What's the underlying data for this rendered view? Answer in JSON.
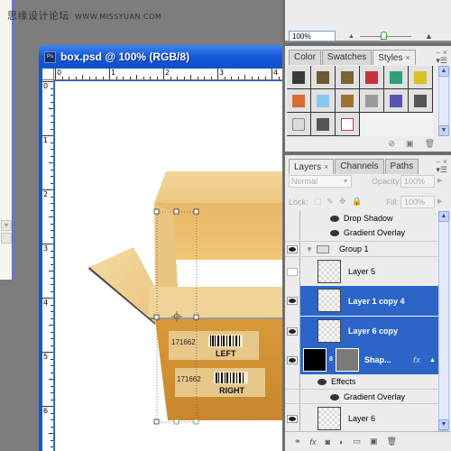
{
  "watermark": {
    "chinese": "思缘设计论坛",
    "url": "WWW.MISSYUAN.COM"
  },
  "document": {
    "title": "box.psd @ 100% (RGB/8)",
    "app_icon": "Ps",
    "ruler_h_labels": [
      "0",
      "1",
      "2",
      "3",
      "4"
    ],
    "ruler_v_labels": [
      "0",
      "1",
      "2",
      "3",
      "4",
      "5",
      "6"
    ],
    "artwork": {
      "label_numbers": [
        "171662",
        "171662"
      ],
      "label_texts": [
        "LEFT",
        "RIGHT"
      ]
    }
  },
  "navigator": {
    "zoom_value": "100%",
    "zoom_slider_fraction": 0.45,
    "zoom_out_icon": "small-mountain-icon",
    "zoom_in_icon": "large-mountain-icon"
  },
  "styles_panel": {
    "tabs": [
      {
        "label": "Color",
        "active": false
      },
      {
        "label": "Swatches",
        "active": false
      },
      {
        "label": "Styles",
        "active": true,
        "closable": true
      }
    ],
    "swatches": [
      {
        "name": "dark-metal",
        "color": "#3a3a3a"
      },
      {
        "name": "bronze",
        "color": "#6e5a2e"
      },
      {
        "name": "bronze-2",
        "color": "#7a6432"
      },
      {
        "name": "red-gradient",
        "color": "#c8303c"
      },
      {
        "name": "rainbow",
        "color": "#2ea07a"
      },
      {
        "name": "gold",
        "color": "#d6c12a"
      },
      {
        "name": "sunset",
        "color": "#d86a34"
      },
      {
        "name": "sky-blue",
        "color": "#8cc7ef"
      },
      {
        "name": "landscape",
        "color": "#a07030"
      },
      {
        "name": "noise",
        "color": "#9a9a9a"
      },
      {
        "name": "purple-blue",
        "color": "#5a54b4"
      },
      {
        "name": "dark-gray",
        "color": "#555555"
      },
      {
        "name": "light-gray-rounded",
        "color": "#dcdcdc"
      },
      {
        "name": "dark-gray-2",
        "color": "#555555"
      },
      {
        "name": "none-red-outline",
        "color": "#ffffff"
      }
    ],
    "footer_icons": [
      "clear-style-icon",
      "new-style-icon",
      "delete-icon"
    ]
  },
  "layers_panel": {
    "tabs": [
      {
        "label": "Layers",
        "active": true,
        "closable": true
      },
      {
        "label": "Channels",
        "active": false
      },
      {
        "label": "Paths",
        "active": false
      }
    ],
    "blend_mode": "Normal",
    "opacity_label": "Opacity:",
    "opacity_value": "100%",
    "lock_label": "Lock:",
    "fill_label": "Fill:",
    "fill_value": "100%",
    "rows": [
      {
        "type": "effect",
        "label": "Drop Shadow"
      },
      {
        "type": "effect",
        "label": "Gradient Overlay"
      },
      {
        "type": "group",
        "label": "Group 1",
        "visible": true
      },
      {
        "type": "layer",
        "label": "Layer 5",
        "visible": false,
        "selected": false
      },
      {
        "type": "layer",
        "label": "Layer 1 copy 4",
        "visible": true,
        "selected": true
      },
      {
        "type": "layer",
        "label": "Layer 6 copy",
        "visible": true,
        "selected": true
      },
      {
        "type": "shape",
        "label": "Shap...",
        "visible": true,
        "selected": true,
        "fx": "fx"
      },
      {
        "type": "effects-header",
        "label": "Effects"
      },
      {
        "type": "effect",
        "label": "Gradient Overlay"
      },
      {
        "type": "layer",
        "label": "Layer 6",
        "visible": true,
        "selected": false
      }
    ],
    "footer_icons": [
      "link-layers-icon",
      "fx-icon",
      "add-mask-icon",
      "adjustment-layer-icon",
      "new-group-icon",
      "new-layer-icon",
      "delete-icon"
    ]
  },
  "colors": {
    "selection_blue": "#2c65c7",
    "title_blue": "#1457d8",
    "workspace_gray": "#7d7d7d",
    "cardboard": "#f2cf8a"
  }
}
